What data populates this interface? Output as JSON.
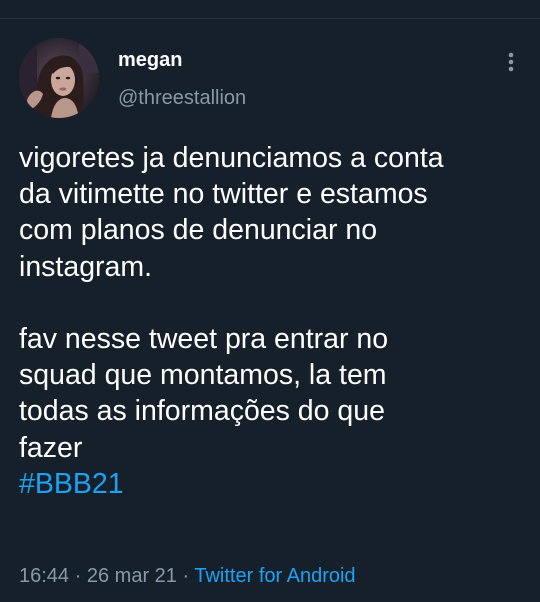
{
  "user": {
    "display_name": "megan",
    "handle": "@threestallion"
  },
  "tweet": {
    "paragraph_1": [
      "vigoretes ja denunciamos a conta",
      "da vitimette no twitter e estamos",
      "com planos de denunciar no",
      "instagram."
    ],
    "paragraph_2": [
      "fav nesse tweet pra entrar no",
      "squad que montamos, la tem",
      "todas as informações do que",
      "fazer"
    ],
    "hashtag": "#BBB21"
  },
  "meta": {
    "time": "16:44",
    "separator": "·",
    "date": "26 mar 21",
    "source": "Twitter for Android"
  },
  "icons": {
    "more": "more-vertical-icon",
    "avatar": "avatar"
  },
  "colors": {
    "background": "#15202b",
    "text": "#ffffff",
    "secondary": "#8899a6",
    "accent": "#1da1f2"
  }
}
